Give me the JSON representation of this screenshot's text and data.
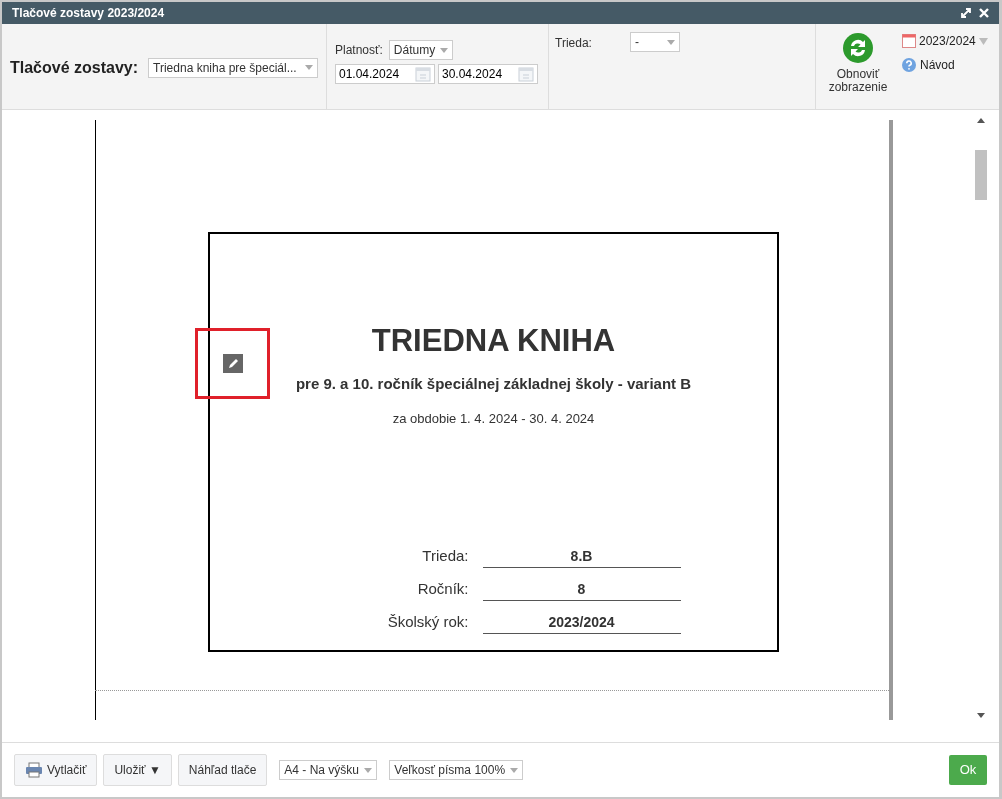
{
  "window": {
    "title": "Tlačové zostavy 2023/2024"
  },
  "toolbar": {
    "reports_label": "Tlačové zostavy:",
    "report_select": "Triedna kniha pre špeciál...",
    "validity_label": "Platnosť:",
    "validity_select": "Dátumy",
    "date_from": "01.04.2024",
    "date_to": "30.04.2024",
    "class_label": "Trieda:",
    "class_select": "-",
    "refresh_button": "Obnoviť zobrazenie",
    "school_year": "2023/2024",
    "help_link": "Návod"
  },
  "document": {
    "title": "TRIEDNA KNIHA",
    "subtitle": "pre 9. a 10. ročník špeciálnej základnej školy - variant B",
    "period": "za obdobie 1. 4. 2024 - 30. 4. 2024",
    "fields": [
      {
        "label": "Trieda:",
        "value": "8.B"
      },
      {
        "label": "Ročník:",
        "value": "8"
      },
      {
        "label": "Školský rok:",
        "value": "2023/2024"
      }
    ]
  },
  "footer": {
    "print_button": "Vytlačiť",
    "save_button": "Uložiť ▼",
    "preview_button": "Náhľad tlače",
    "orientation_select": "A4 - Na výšku",
    "font_size_select": "Veľkosť písma 100%",
    "ok_button": "Ok"
  }
}
